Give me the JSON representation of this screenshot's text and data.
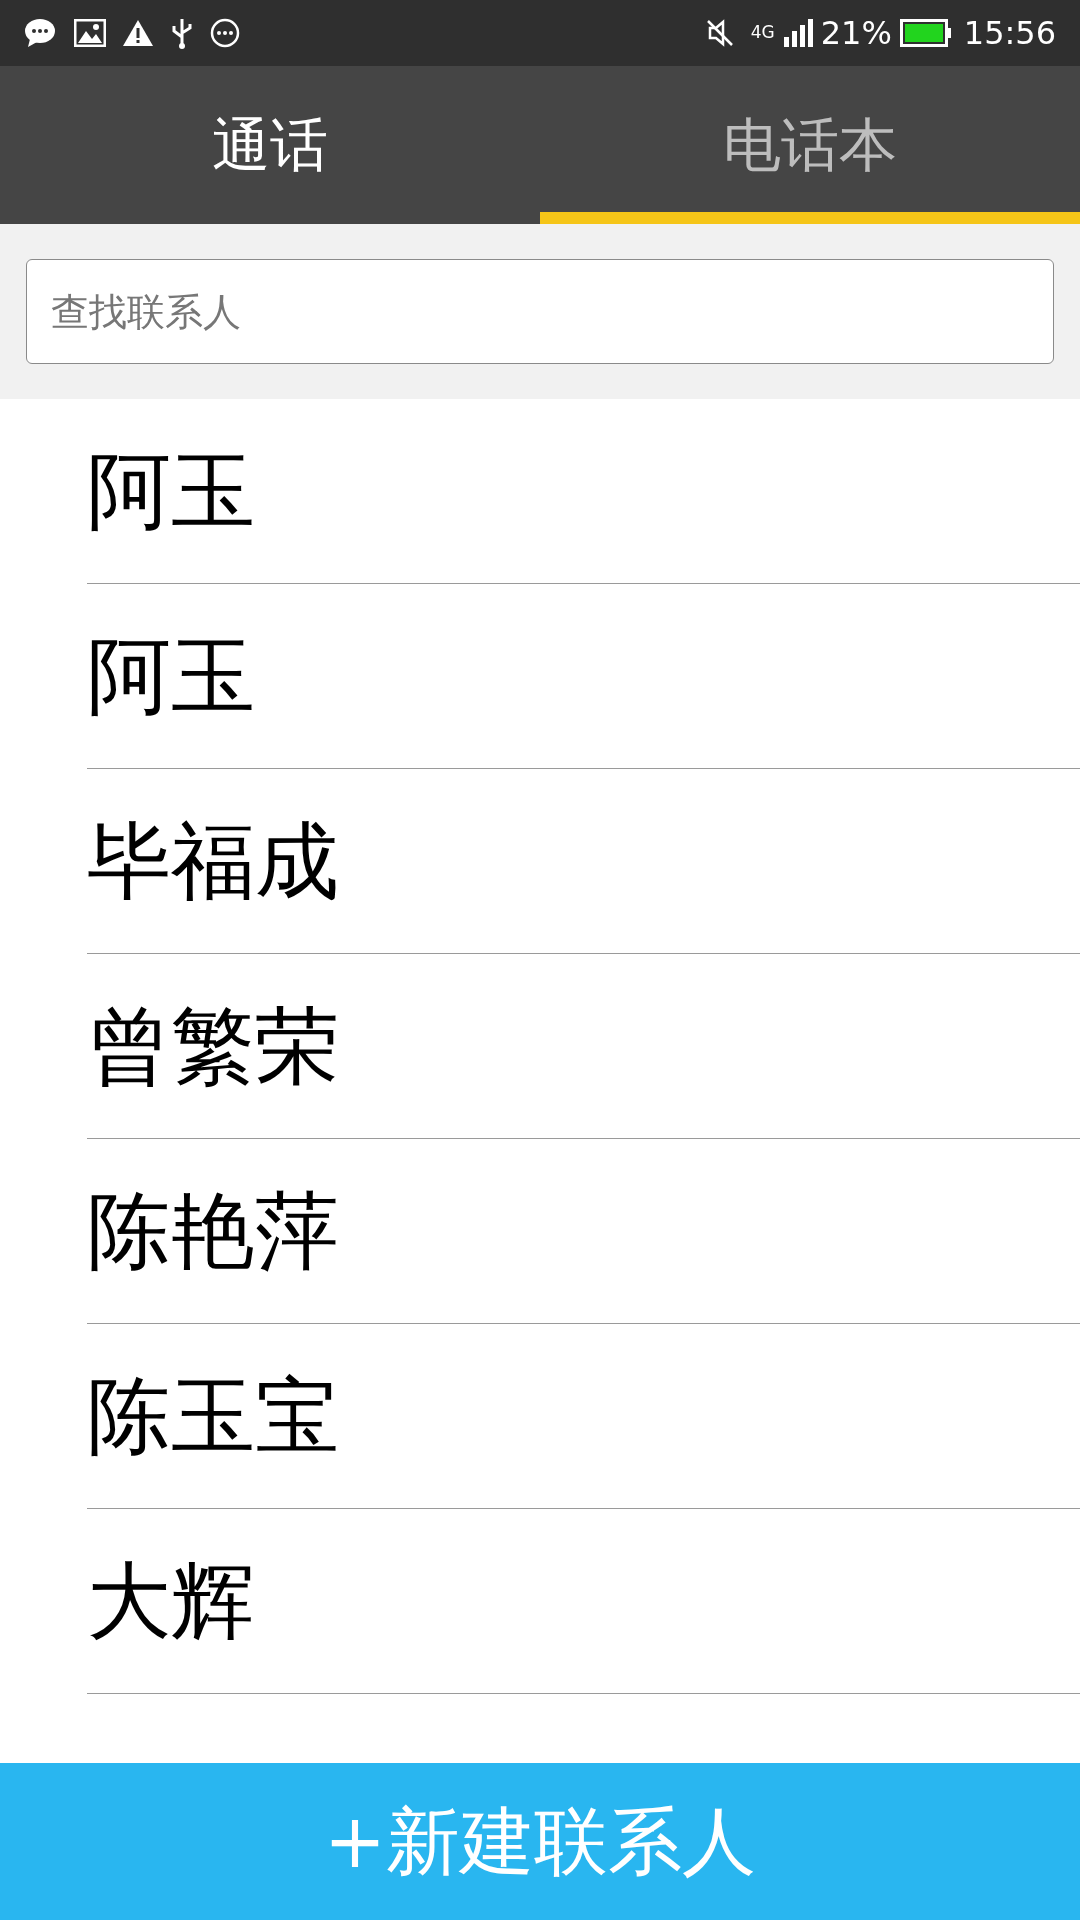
{
  "status_bar": {
    "network": "4G",
    "battery": "21%",
    "time": "15:56"
  },
  "tabs": [
    {
      "label": "通话",
      "selected": false
    },
    {
      "label": "电话本",
      "selected": true
    }
  ],
  "search": {
    "placeholder": "查找联系人"
  },
  "contacts": [
    {
      "name": "阿玉"
    },
    {
      "name": "阿玉"
    },
    {
      "name": "毕福成"
    },
    {
      "name": "曾繁荣"
    },
    {
      "name": "陈艳萍"
    },
    {
      "name": "陈玉宝"
    },
    {
      "name": "大辉"
    }
  ],
  "new_contact_button": {
    "label": "+新建联系人"
  }
}
